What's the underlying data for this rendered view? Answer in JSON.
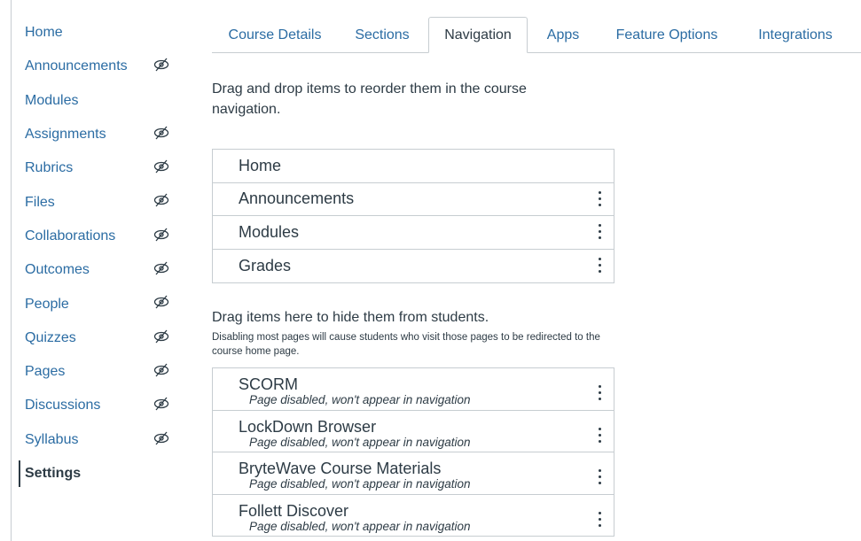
{
  "sidebar": {
    "items": [
      {
        "label": "Home",
        "hidden": false
      },
      {
        "label": "Announcements",
        "hidden": true
      },
      {
        "label": "Modules",
        "hidden": false
      },
      {
        "label": "Assignments",
        "hidden": true
      },
      {
        "label": "Rubrics",
        "hidden": true
      },
      {
        "label": "Files",
        "hidden": true
      },
      {
        "label": "Collaborations",
        "hidden": true
      },
      {
        "label": "Outcomes",
        "hidden": true
      },
      {
        "label": "People",
        "hidden": true
      },
      {
        "label": "Quizzes",
        "hidden": true
      },
      {
        "label": "Pages",
        "hidden": true
      },
      {
        "label": "Discussions",
        "hidden": true
      },
      {
        "label": "Syllabus",
        "hidden": true
      },
      {
        "label": "Settings",
        "hidden": false,
        "active": true
      }
    ]
  },
  "tabs": [
    {
      "label": "Course Details"
    },
    {
      "label": "Sections"
    },
    {
      "label": "Navigation",
      "active": true
    },
    {
      "label": "Apps"
    },
    {
      "label": "Feature Options"
    },
    {
      "label": "Integrations"
    }
  ],
  "intro": "Drag and drop items to reorder them in the course navigation.",
  "enabled_items": [
    {
      "label": "Home",
      "menu": false
    },
    {
      "label": "Announcements",
      "menu": true
    },
    {
      "label": "Modules",
      "menu": true
    },
    {
      "label": "Grades",
      "menu": true
    }
  ],
  "hidden_section": {
    "title": "Drag items here to hide them from students.",
    "note": "Disabling most pages will cause students who visit those pages to be redirected to the course home page."
  },
  "disabled_items": [
    {
      "label": "SCORM",
      "note": "Page disabled, won't appear in navigation"
    },
    {
      "label": "LockDown Browser",
      "note": "Page disabled, won't appear in navigation"
    },
    {
      "label": "BryteWave Course Materials",
      "note": "Page disabled, won't appear in navigation"
    },
    {
      "label": "Follett Discover",
      "note": "Page disabled, won't appear in navigation"
    }
  ],
  "colors": {
    "link": "#2b6ca3",
    "text": "#2d3b45",
    "border": "#c7cdd1"
  },
  "icons": {
    "hidden": "eye-slash-icon",
    "menu": "kebab-menu-icon"
  }
}
